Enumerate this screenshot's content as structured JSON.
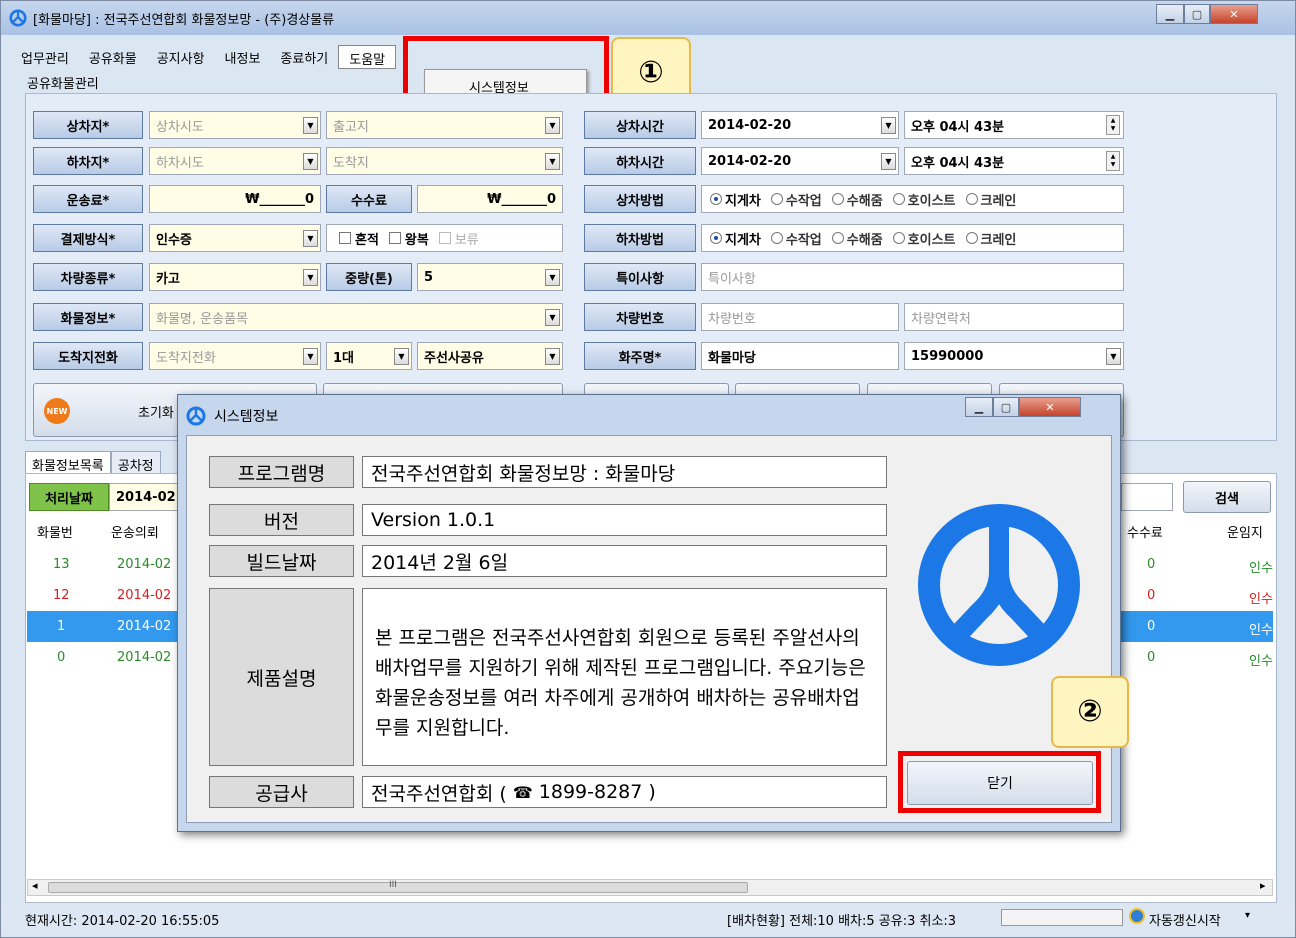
{
  "window": {
    "title": "[화물마당] : 전국주선연합회 화물정보망 - (주)경상물류"
  },
  "menu": {
    "items": [
      "업무관리",
      "공유화물",
      "공지사항",
      "내정보",
      "종료하기",
      "도움말"
    ],
    "dropdown_item": "시스템정보"
  },
  "annotations": {
    "one": "①",
    "two": "②"
  },
  "form": {
    "section_label": "공유화물관리",
    "load_place_label": "상차지*",
    "load_city_placeholder": "상차시도",
    "load_dest_placeholder": "출고지",
    "unload_place_label": "하차지*",
    "unload_city_placeholder": "하차시도",
    "unload_dest_placeholder": "도착지",
    "freight_label": "운송료*",
    "freight_value": "₩_______0",
    "fee_label": "수수료",
    "fee_value": "₩_______0",
    "payment_label": "결제방식*",
    "payment_value": "인수증",
    "check_mixed": "혼적",
    "check_round": "왕복",
    "check_hold": "보류",
    "vehicle_type_label": "차량종류*",
    "vehicle_type_value": "카고",
    "weight_label": "중량(톤)",
    "weight_value": "5",
    "cargo_info_label": "화물정보*",
    "cargo_info_placeholder": "화물명, 운송품목",
    "arrival_phone_label": "도착지전화",
    "arrival_phone_placeholder": "도착지전화",
    "count_value": "1대",
    "share_value": "주선사공유",
    "load_time_label": "상차시간",
    "load_date": "2014-02-20",
    "load_time": "오후 04시 43분",
    "unload_time_label": "하차시간",
    "unload_date": "2014-02-20",
    "unload_time": "오후 04시 43분",
    "load_method_label": "상차방법",
    "unload_method_label": "하차방법",
    "methods": [
      "지게차",
      "수작업",
      "수해줌",
      "호이스트",
      "크레인"
    ],
    "special_label": "특이사항",
    "special_placeholder": "특이사항",
    "vehicle_no_label": "차량번호",
    "vehicle_no_placeholder": "차량번호",
    "vehicle_contact_placeholder": "차량연락처",
    "shipper_label": "화주명*",
    "shipper_value": "화물마당",
    "shipper_phone": "15990000",
    "reset_label": "초기화"
  },
  "list": {
    "tabs": [
      "화물정보목록",
      "공차정"
    ],
    "date_label": "처리날짜",
    "date_value": "2014-02",
    "search_label": "검색",
    "columns": [
      "화물번",
      "운송의뢰",
      "수수료",
      "운임지"
    ],
    "rows": [
      {
        "no": "13",
        "date": "2014-02",
        "fee": "0",
        "pay": "인수"
      },
      {
        "no": "12",
        "date": "2014-02",
        "fee": "0",
        "pay": "인수"
      },
      {
        "no": "1",
        "date": "2014-02",
        "fee": "0",
        "pay": "인수"
      },
      {
        "no": "0",
        "date": "2014-02",
        "fee": "0",
        "pay": "인수"
      }
    ],
    "scroll_mark": "III"
  },
  "status": {
    "current_time": "현재시간:  2014-02-20 16:55:05",
    "dispatch": "[배차현황]  전체:10 배차:5 공유:3 취소:3",
    "auto_refresh": "자동갱신시작"
  },
  "dialog": {
    "title": "시스템정보",
    "program_label": "프로그램명",
    "program_value": "전국주선연합회 화물정보망 : 화물마당",
    "version_label": "버전",
    "version_value": "Version 1.0.1",
    "build_label": "빌드날짜",
    "build_value": "2014년 2월 6일",
    "desc_label": "제품설명",
    "desc_value": "본 프로그램은 전국주선사연합회 회원으로 등록된 주알선사의 배차업무를 지원하기 위해 제작된 프로그램입니다. 주요기능은 화물운송정보를 여러 차주에게 공개하여 배차하는 공유배차업무를 지원합니다.",
    "supplier_label": "공급사",
    "supplier_name": "전국주선연합회 (",
    "supplier_phone": "1899-8287 )",
    "close_label": "닫기"
  },
  "colors": {
    "accent_blue": "#1a73e8",
    "selection": "#3399ee",
    "annotation_red": "#e00000",
    "logo_blue": "#1b78e6"
  }
}
